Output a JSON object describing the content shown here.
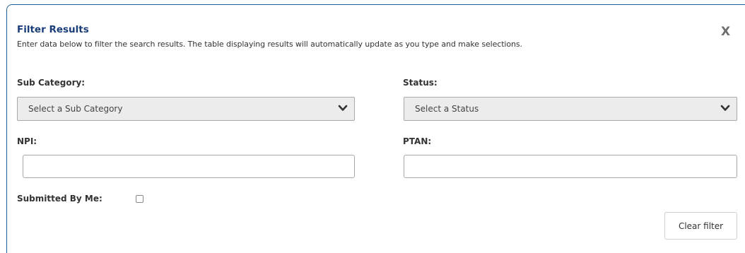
{
  "filter_panel": {
    "title": "Filter Results",
    "description": "Enter data below to filter the search results. The table displaying results will automatically update as you type and make selections.",
    "close_label": "X"
  },
  "fields": {
    "sub_category": {
      "label": "Sub Category:",
      "selected": "Select a Sub Category"
    },
    "status": {
      "label": "Status:",
      "selected": "Select a Status"
    },
    "npi": {
      "label": "NPI:",
      "value": "",
      "placeholder": ""
    },
    "ptan": {
      "label": "PTAN:",
      "value": "",
      "placeholder": ""
    },
    "submitted_by_me": {
      "label": "Submitted By Me:",
      "checked": false
    }
  },
  "actions": {
    "clear_filter_label": "Clear filter"
  },
  "colors": {
    "title": "#1a3d7a",
    "border_accent": "#1f5f97",
    "select_bg": "#ececec"
  }
}
